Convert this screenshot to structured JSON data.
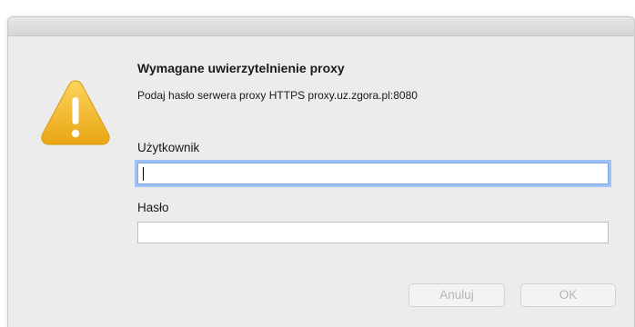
{
  "dialog": {
    "title": "Wymagane uwierzytelnienie proxy",
    "message": "Podaj hasło serwera proxy HTTPS proxy.uz.zgora.pl:8080",
    "icon": "warning-icon"
  },
  "form": {
    "username_label": "Użytkownik",
    "username_value": "",
    "password_label": "Hasło",
    "password_value": ""
  },
  "buttons": {
    "cancel_label": "Anuluj",
    "ok_label": "OK"
  },
  "colors": {
    "warning": "#f4b81f",
    "focus_ring": "#9fc2f2",
    "disabled_text": "#b5b5b5"
  }
}
